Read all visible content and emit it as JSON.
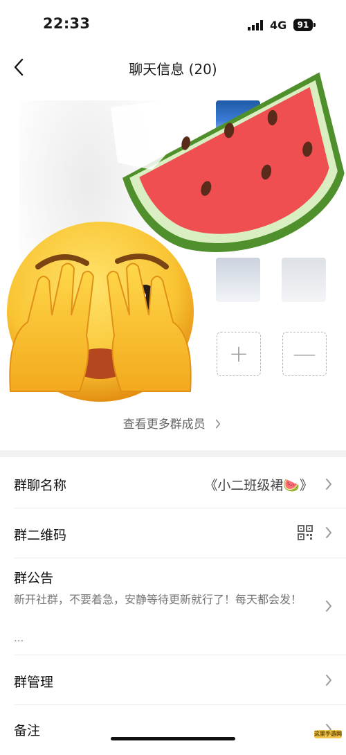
{
  "status_bar": {
    "time": "22:33",
    "network": "4G",
    "battery": "91"
  },
  "header": {
    "title": "聊天信息 (20)"
  },
  "members": {
    "more_label": "查看更多群成员",
    "add_symbol": "+",
    "remove_symbol": "—"
  },
  "settings": {
    "group_name": {
      "label": "群聊名称",
      "value": "《小二班级裙🍉》"
    },
    "qr_code": {
      "label": "群二维码"
    },
    "announcement": {
      "label": "群公告",
      "text": "新开社群，不要着急，安静等待更新就行了！每天都会发！",
      "ellipsis": "..."
    },
    "manage": {
      "label": "群管理"
    },
    "remark": {
      "label": "备注"
    }
  },
  "watermark": {
    "text": "这里手游网"
  },
  "colors": {
    "divider": "#f2f2f2",
    "text_primary": "#111111",
    "text_secondary": "#777777"
  }
}
